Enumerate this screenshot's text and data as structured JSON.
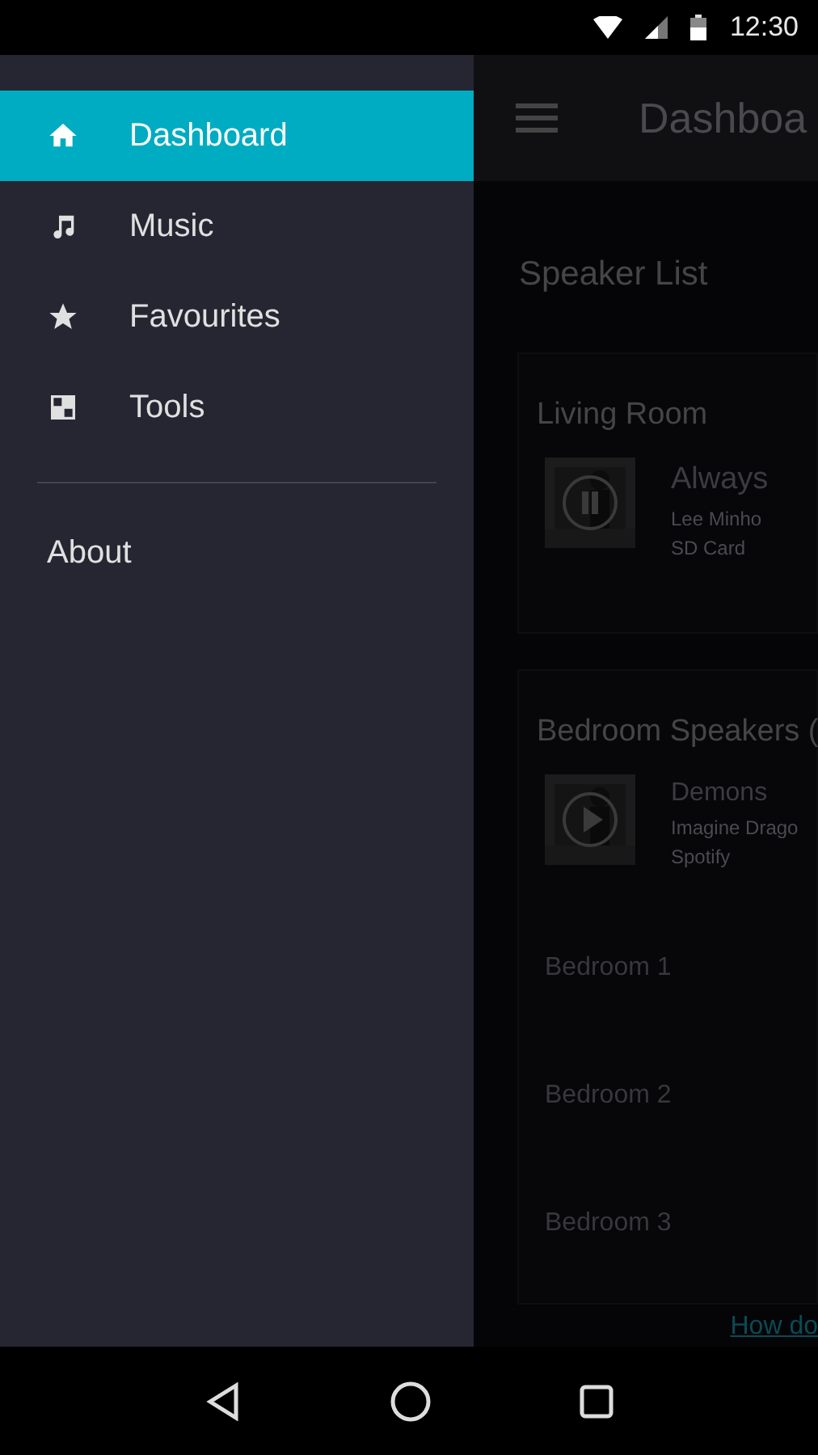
{
  "status_bar": {
    "time": "12:30"
  },
  "drawer": {
    "items": [
      {
        "label": "Dashboard",
        "selected": true
      },
      {
        "label": "Music",
        "selected": false
      },
      {
        "label": "Favourites",
        "selected": false
      },
      {
        "label": "Tools",
        "selected": false
      }
    ],
    "secondary": [
      {
        "label": "About"
      }
    ]
  },
  "app_bar": {
    "title": "Dashboa"
  },
  "content": {
    "heading": "Speaker List",
    "groups": [
      {
        "name": "Living Room",
        "track": "Always",
        "artist": "Lee Minho",
        "source": "SD Card",
        "playing": true
      },
      {
        "name": "Bedroom Speakers (",
        "track": "Demons",
        "artist": "Imagine Drago",
        "source": "Spotify",
        "playing": false,
        "speakers": [
          {
            "name": "Bedroom 1"
          },
          {
            "name": "Bedroom 2"
          },
          {
            "name": "Bedroom 3"
          }
        ]
      }
    ],
    "link": "How do"
  }
}
